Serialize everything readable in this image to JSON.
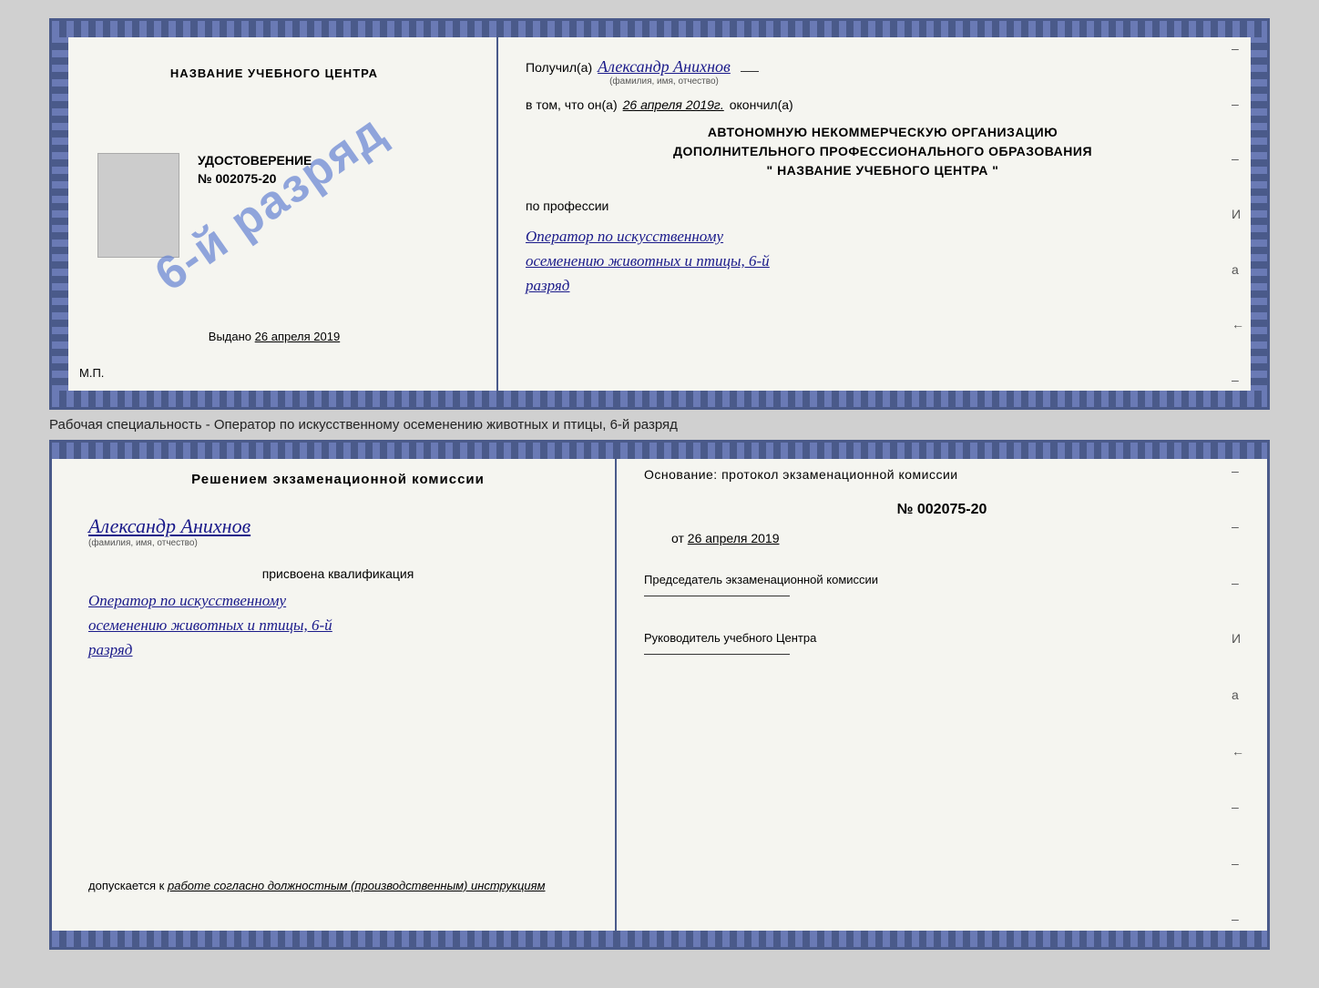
{
  "cert_top": {
    "school_name": "НАЗВАНИЕ УЧЕБНОГО ЦЕНТРА",
    "cert_label": "УДОСТОВЕРЕНИЕ",
    "cert_number": "№ 002075-20",
    "stamp_text": "6-й разряд",
    "issued_label": "Выдано",
    "issued_date": "26 апреля 2019",
    "mp_label": "М.П.",
    "received_label": "Получил(а)",
    "received_name": "Александр Анихнов",
    "received_subtitle": "(фамилия, имя, отчество)",
    "date_label": "в том, что он(а)",
    "date_value": "26 апреля 2019г.",
    "finished_label": "окончил(а)",
    "org_line1": "АВТОНОМНУЮ НЕКОММЕРЧЕСКУЮ ОРГАНИЗАЦИЮ",
    "org_line2": "ДОПОЛНИТЕЛЬНОГО ПРОФЕССИОНАЛЬНОГО ОБРАЗОВАНИЯ",
    "org_line3": "\"  НАЗВАНИЕ УЧЕБНОГО ЦЕНТРА  \"",
    "profession_label": "по профессии",
    "profession_value": "Оператор по искусственному осеменению животных и птицы, 6-й разряд"
  },
  "annotation": {
    "text": "Рабочая специальность - Оператор по искусственному осеменению животных и птицы, 6-й разряд"
  },
  "cert_bottom": {
    "decision_title": "Решением экзаменационной комиссии",
    "person_name": "Александр Анихнов",
    "person_subtitle": "(фамилия, имя, отчество)",
    "qualification_label": "присвоена квалификация",
    "qualification_value": "Оператор по искусственному осеменению животных и птицы, 6-й разряд",
    "admission_label": "допускается к",
    "admission_value": "работе согласно должностным (производственным) инструкциям",
    "basis_label": "Основание: протокол экзаменационной комиссии",
    "protocol_number": "№ 002075-20",
    "protocol_date_prefix": "от",
    "protocol_date": "26 апреля 2019",
    "chairman_label": "Председатель экзаменационной комиссии",
    "director_label": "Руководитель учебного Центра"
  }
}
